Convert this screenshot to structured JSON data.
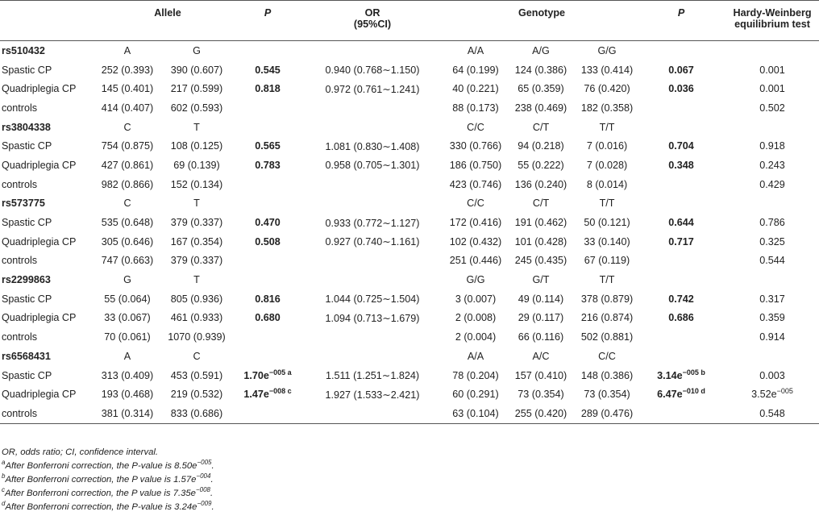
{
  "header": {
    "allele": "Allele",
    "p1": "P",
    "or": "OR",
    "ci": "(95%CI)",
    "genotype": "Genotype",
    "p2": "P",
    "hwe": "Hardy-Weinberg equilibrium test"
  },
  "rows": [
    {
      "kind": "snp",
      "name": "rs510432",
      "a1": "A",
      "a2": "G",
      "g1": "A/A",
      "g2": "A/G",
      "g3": "G/G"
    },
    {
      "kind": "data",
      "label": "Spastic CP",
      "a1": "252 (0.393)",
      "a2": "390 (0.607)",
      "p": "0.545",
      "or": "0.940 (0.768∼1.150)",
      "g1": "64 (0.199)",
      "g2": "124 (0.386)",
      "g3": "133 (0.414)",
      "p2": "0.067",
      "hwe": "0.001"
    },
    {
      "kind": "data",
      "label": "Quadriplegia CP",
      "a1": "145 (0.401)",
      "a2": "217 (0.599)",
      "p": "0.818",
      "or": "0.972 (0.761∼1.241)",
      "g1": "40 (0.221)",
      "g2": "65 (0.359)",
      "g3": "76 (0.420)",
      "p2": "0.036",
      "hwe": "0.001"
    },
    {
      "kind": "data",
      "label": "controls",
      "a1": "414 (0.407)",
      "a2": "602 (0.593)",
      "p": "",
      "or": "",
      "g1": "88 (0.173)",
      "g2": "238 (0.469)",
      "g3": "182 (0.358)",
      "p2": "",
      "hwe": "0.502"
    },
    {
      "kind": "snp",
      "name": "rs3804338",
      "a1": "C",
      "a2": "T",
      "g1": "C/C",
      "g2": "C/T",
      "g3": "T/T"
    },
    {
      "kind": "data",
      "label": "Spastic CP",
      "a1": "754 (0.875)",
      "a2": "108 (0.125)",
      "p": "0.565",
      "or": "1.081 (0.830∼1.408)",
      "g1": "330 (0.766)",
      "g2": "94 (0.218)",
      "g3": "7 (0.016)",
      "p2": "0.704",
      "hwe": "0.918"
    },
    {
      "kind": "data",
      "label": "Quadriplegia CP",
      "a1": "427 (0.861)",
      "a2": "69 (0.139)",
      "p": "0.783",
      "or": "0.958 (0.705∼1.301)",
      "g1": "186 (0.750)",
      "g2": "55 (0.222)",
      "g3": "7 (0.028)",
      "p2": "0.348",
      "hwe": "0.243"
    },
    {
      "kind": "data",
      "label": "controls",
      "a1": "982 (0.866)",
      "a2": "152 (0.134)",
      "p": "",
      "or": "",
      "g1": "423 (0.746)",
      "g2": "136 (0.240)",
      "g3": "8 (0.014)",
      "p2": "",
      "hwe": "0.429"
    },
    {
      "kind": "snp",
      "name": "rs573775",
      "a1": "C",
      "a2": "T",
      "g1": "C/C",
      "g2": "C/T",
      "g3": "T/T"
    },
    {
      "kind": "data",
      "label": "Spastic CP",
      "a1": "535 (0.648)",
      "a2": "379 (0.337)",
      "p": "0.470",
      "or": "0.933 (0.772∼1.127)",
      "g1": "172 (0.416)",
      "g2": "191 (0.462)",
      "g3": "50 (0.121)",
      "p2": "0.644",
      "hwe": "0.786"
    },
    {
      "kind": "data",
      "label": "Quadriplegia CP",
      "a1": "305 (0.646)",
      "a2": "167 (0.354)",
      "p": "0.508",
      "or": "0.927 (0.740∼1.161)",
      "g1": "102 (0.432)",
      "g2": "101 (0.428)",
      "g3": "33 (0.140)",
      "p2": "0.717",
      "hwe": "0.325"
    },
    {
      "kind": "data",
      "label": "controls",
      "a1": "747 (0.663)",
      "a2": "379 (0.337)",
      "p": "",
      "or": "",
      "g1": "251 (0.446)",
      "g2": "245 (0.435)",
      "g3": "67 (0.119)",
      "p2": "",
      "hwe": "0.544"
    },
    {
      "kind": "snp",
      "name": "rs2299863",
      "a1": "G",
      "a2": "T",
      "g1": "G/G",
      "g2": "G/T",
      "g3": "T/T"
    },
    {
      "kind": "data",
      "label": "Spastic CP",
      "a1": "55 (0.064)",
      "a2": "805 (0.936)",
      "p": "0.816",
      "or": "1.044 (0.725∼1.504)",
      "g1": "3 (0.007)",
      "g2": "49 (0.114)",
      "g3": "378 (0.879)",
      "p2": "0.742",
      "hwe": "0.317"
    },
    {
      "kind": "data",
      "label": "Quadriplegia CP",
      "a1": "33 (0.067)",
      "a2": "461 (0.933)",
      "p": "0.680",
      "or": "1.094 (0.713∼1.679)",
      "g1": "2 (0.008)",
      "g2": "29 (0.117)",
      "g3": "216 (0.874)",
      "p2": "0.686",
      "hwe": "0.359"
    },
    {
      "kind": "data",
      "label": "controls",
      "a1": "70 (0.061)",
      "a2": "1070 (0.939)",
      "p": "",
      "or": "",
      "g1": "2 (0.004)",
      "g2": "66 (0.116)",
      "g3": "502 (0.881)",
      "p2": "",
      "hwe": "0.914"
    },
    {
      "kind": "snp",
      "name": "rs6568431",
      "a1": "A",
      "a2": "C",
      "g1": "A/A",
      "g2": "A/C",
      "g3": "C/C"
    },
    {
      "kind": "data",
      "label": "Spastic CP",
      "a1": "313 (0.409)",
      "a2": "453 (0.591)",
      "p": "1.70e",
      "p_sup": "−005 a",
      "or": "1.511 (1.251∼1.824)",
      "g1": "78 (0.204)",
      "g2": "157 (0.410)",
      "g3": "148 (0.386)",
      "p2": "3.14e",
      "p2_sup": "−005 b",
      "hwe": "0.003"
    },
    {
      "kind": "data",
      "label": "Quadriplegia CP",
      "a1": "193 (0.468)",
      "a2": "219 (0.532)",
      "p": "1.47e",
      "p_sup": "−008 c",
      "or": "1.927 (1.533∼2.421)",
      "g1": "60 (0.291)",
      "g2": "73 (0.354)",
      "g3": "73 (0.354)",
      "p2": "6.47e",
      "p2_sup": "−010 d",
      "hwe": "3.52e",
      "hwe_sup": "−005"
    },
    {
      "kind": "data",
      "label": "controls",
      "a1": "381 (0.314)",
      "a2": "833 (0.686)",
      "p": "",
      "or": "",
      "g1": "63 (0.104)",
      "g2": "255 (0.420)",
      "g3": "289 (0.476)",
      "p2": "",
      "hwe": "0.548"
    }
  ],
  "footnotes": {
    "abbrev": "OR, odds ratio; CI, confidence interval.",
    "a": {
      "mark": "a",
      "text": "After Bonferroni correction, the P-value is 8.50e",
      "exp": "−005",
      "end": "."
    },
    "b": {
      "mark": "b",
      "text": "After Bonferroni correction, the P value is 1.57e",
      "exp": "−004",
      "end": "."
    },
    "c": {
      "mark": "c",
      "text": "After Bonferroni correction, the P value is 7.35e",
      "exp": "−008",
      "end": "."
    },
    "d": {
      "mark": "d",
      "text": "After Bonferroni correction, the P-value is 3.24e",
      "exp": "−009",
      "end": "."
    }
  }
}
